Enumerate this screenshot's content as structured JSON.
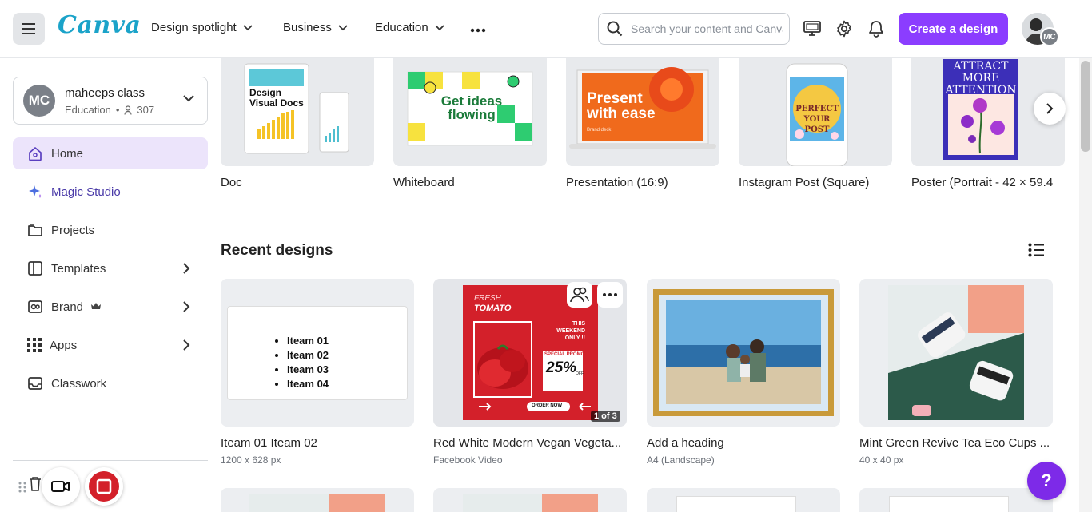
{
  "header": {
    "logo": "Canva",
    "nav": [
      "Design spotlight",
      "Business",
      "Education"
    ],
    "search_placeholder": "Search your content and Canva",
    "create_label": "Create a design",
    "avatar_initials": "MC"
  },
  "sidebar": {
    "account": {
      "initials": "MC",
      "name": "maheeps class",
      "type": "Education",
      "members": "307"
    },
    "items": [
      {
        "label": "Home",
        "icon": "home-icon",
        "active": true
      },
      {
        "label": "Magic Studio",
        "icon": "sparkle-icon"
      },
      {
        "label": "Projects",
        "icon": "folder-icon"
      },
      {
        "label": "Templates",
        "icon": "template-icon",
        "arrow": true
      },
      {
        "label": "Brand",
        "icon": "brand-icon",
        "arrow": true,
        "crown": true
      },
      {
        "label": "Apps",
        "icon": "apps-icon",
        "arrow": true
      },
      {
        "label": "Classwork",
        "icon": "tray-icon"
      }
    ]
  },
  "templates": [
    {
      "label": "Doc",
      "art_text": "Design Visual Docs"
    },
    {
      "label": "Whiteboard",
      "art_text": "Get ideas flowing"
    },
    {
      "label": "Presentation (16:9)",
      "art_text": "Present with ease",
      "art_sub": "Brand deck"
    },
    {
      "label": "Instagram Post (Square)",
      "art_text": "PERFECT YOUR POST"
    },
    {
      "label": "Poster (Portrait - 42 × 59.4",
      "art_text": "ATTRACT MORE ATTENTION"
    }
  ],
  "recent": {
    "title": "Recent designs",
    "cards": [
      {
        "title": "Iteam 01 Iteam 02",
        "sub": "1200 x 628 px",
        "items": [
          "Iteam 01",
          "Iteam 02",
          "Iteam 03",
          "Iteam 04"
        ]
      },
      {
        "title": "Red White Modern Vegan Vegeta...",
        "sub": "Facebook Video",
        "page_badge": "1 of 3",
        "art": {
          "fresh": "FRESH",
          "tomato": "TOMATO",
          "weekend": "THIS WEEKEND ONLY !!",
          "promo": "SPECIAL PROMO",
          "pct": "25%",
          "off": "OFF",
          "order": "ORDER NOW"
        }
      },
      {
        "title": "Add a heading",
        "sub": "A4 (Landscape)"
      },
      {
        "title": "Mint Green Revive Tea Eco Cups ...",
        "sub": "40 x 40 px"
      }
    ]
  },
  "help_label": "?",
  "colors": {
    "accent": "#8b3dff",
    "active_bg": "#ece4fb",
    "tomato_red": "#d3202a"
  }
}
